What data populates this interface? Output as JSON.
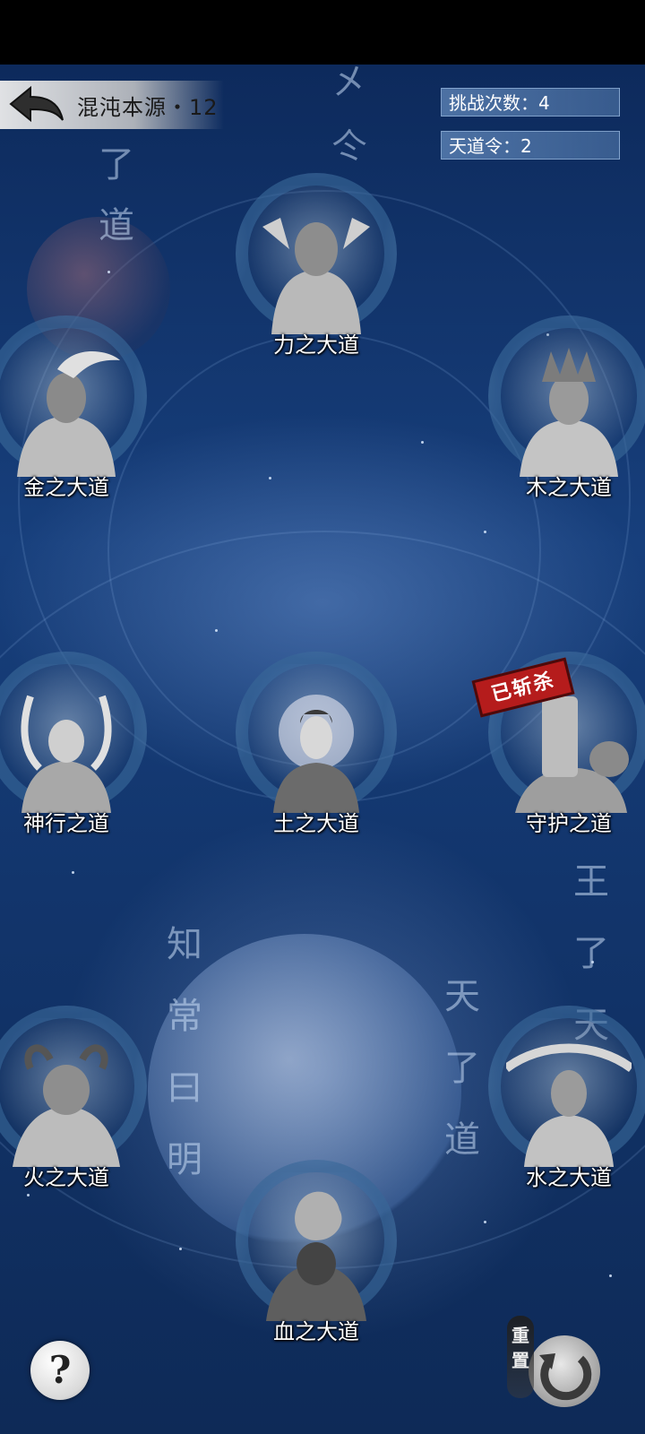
{
  "header": {
    "title": "混沌本源・12",
    "back_icon": "back-arrow-icon"
  },
  "stats": {
    "challenge": "挑战次数：4",
    "token": "天道令：2"
  },
  "nodes": [
    {
      "label": "力之大道"
    },
    {
      "label": "金之大道"
    },
    {
      "label": "木之大道"
    },
    {
      "label": "神行之道"
    },
    {
      "label": "土之大道"
    },
    {
      "label": "守护之道"
    },
    {
      "label": "火之大道"
    },
    {
      "label": "水之大道"
    },
    {
      "label": "血之大道"
    }
  ],
  "stamp": {
    "text": "已斩杀"
  },
  "buttons": {
    "help": "?",
    "reset_label": "重置"
  },
  "colors": {
    "background": "#173f7c",
    "stamp_red": "#b51c1c"
  }
}
